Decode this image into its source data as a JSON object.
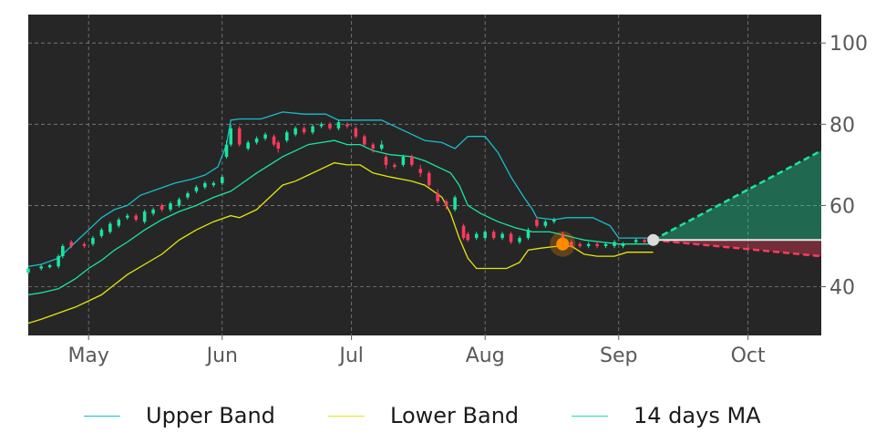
{
  "chart_data": {
    "type": "candlestick",
    "title": "",
    "xlabel": "",
    "ylabel": "",
    "x_axis": {
      "type": "date",
      "range": [
        "2021-04-17",
        "2021-10-18"
      ],
      "tick_labels": [
        {
          "date": "2021-05-01",
          "label": "May"
        },
        {
          "date": "2021-06-01",
          "label": "Jun"
        },
        {
          "date": "2021-07-01",
          "label": "Jul"
        },
        {
          "date": "2021-08-01",
          "label": "Aug"
        },
        {
          "date": "2021-09-01",
          "label": "Sep"
        },
        {
          "date": "2021-10-01",
          "label": "Oct"
        }
      ]
    },
    "y_axis": {
      "range": [
        28,
        107
      ],
      "ticks": [
        40,
        60,
        80,
        100
      ],
      "side": "right"
    },
    "grid": true,
    "background": "#262626",
    "legend": {
      "placement": "bottom",
      "entries": [
        {
          "label": "Upper Band",
          "color": "#17becf"
        },
        {
          "label": "Lower Band",
          "color": "#e5e510"
        },
        {
          "label": "14 days MA",
          "color": "#19e6a0"
        }
      ]
    },
    "series": [
      {
        "name": "Upper Band",
        "color": "#17becf",
        "points": [
          [
            "2021-04-17",
            45
          ],
          [
            "2021-04-20",
            45.5
          ],
          [
            "2021-04-24",
            47
          ],
          [
            "2021-04-28",
            51
          ],
          [
            "2021-05-01",
            54
          ],
          [
            "2021-05-04",
            57
          ],
          [
            "2021-05-07",
            59
          ],
          [
            "2021-05-10",
            60
          ],
          [
            "2021-05-13",
            62.5
          ],
          [
            "2021-05-17",
            64
          ],
          [
            "2021-05-21",
            65.5
          ],
          [
            "2021-05-25",
            66.5
          ],
          [
            "2021-05-28",
            67.5
          ],
          [
            "2021-05-31",
            69.5
          ],
          [
            "2021-06-02",
            75
          ],
          [
            "2021-06-03",
            81
          ],
          [
            "2021-06-05",
            81.3
          ],
          [
            "2021-06-10",
            81.3
          ],
          [
            "2021-06-15",
            83
          ],
          [
            "2021-06-20",
            82.5
          ],
          [
            "2021-06-25",
            82.5
          ],
          [
            "2021-06-28",
            81
          ],
          [
            "2021-07-08",
            81
          ],
          [
            "2021-07-10",
            80
          ],
          [
            "2021-07-14",
            78
          ],
          [
            "2021-07-18",
            76
          ],
          [
            "2021-07-22",
            75.5
          ],
          [
            "2021-07-25",
            74
          ],
          [
            "2021-07-28",
            77
          ],
          [
            "2021-08-01",
            77
          ],
          [
            "2021-08-04",
            73
          ],
          [
            "2021-08-07",
            67
          ],
          [
            "2021-08-10",
            62
          ],
          [
            "2021-08-12",
            59
          ],
          [
            "2021-08-13",
            57
          ],
          [
            "2021-08-17",
            56.5
          ],
          [
            "2021-08-20",
            57
          ],
          [
            "2021-08-26",
            57
          ],
          [
            "2021-08-30",
            55
          ],
          [
            "2021-09-01",
            52
          ],
          [
            "2021-09-03",
            52
          ],
          [
            "2021-09-09",
            52
          ]
        ]
      },
      {
        "name": "Lower Band",
        "color": "#e5e510",
        "points": [
          [
            "2021-04-17",
            31
          ],
          [
            "2021-04-20",
            32
          ],
          [
            "2021-04-24",
            33.5
          ],
          [
            "2021-04-28",
            35
          ],
          [
            "2021-05-01",
            36.5
          ],
          [
            "2021-05-04",
            38
          ],
          [
            "2021-05-07",
            40.5
          ],
          [
            "2021-05-10",
            43
          ],
          [
            "2021-05-14",
            45.5
          ],
          [
            "2021-05-18",
            48
          ],
          [
            "2021-05-22",
            51.5
          ],
          [
            "2021-05-26",
            54
          ],
          [
            "2021-05-30",
            56
          ],
          [
            "2021-06-03",
            57.5
          ],
          [
            "2021-06-05",
            57
          ],
          [
            "2021-06-09",
            59
          ],
          [
            "2021-06-12",
            62
          ],
          [
            "2021-06-15",
            65
          ],
          [
            "2021-06-18",
            66
          ],
          [
            "2021-06-21",
            67.5
          ],
          [
            "2021-06-24",
            69
          ],
          [
            "2021-06-27",
            70.5
          ],
          [
            "2021-06-30",
            70
          ],
          [
            "2021-07-03",
            70
          ],
          [
            "2021-07-06",
            68
          ],
          [
            "2021-07-10",
            67
          ],
          [
            "2021-07-15",
            66
          ],
          [
            "2021-07-18",
            65
          ],
          [
            "2021-07-22",
            62
          ],
          [
            "2021-07-24",
            58
          ],
          [
            "2021-07-26",
            52
          ],
          [
            "2021-07-28",
            47
          ],
          [
            "2021-07-30",
            44.5
          ],
          [
            "2021-08-03",
            44.5
          ],
          [
            "2021-08-06",
            44.5
          ],
          [
            "2021-08-09",
            46
          ],
          [
            "2021-08-11",
            49
          ],
          [
            "2021-08-14",
            49.5
          ],
          [
            "2021-08-18",
            50
          ],
          [
            "2021-08-21",
            50
          ],
          [
            "2021-08-24",
            48
          ],
          [
            "2021-08-27",
            47.5
          ],
          [
            "2021-08-31",
            47.5
          ],
          [
            "2021-09-03",
            48.5
          ],
          [
            "2021-09-09",
            48.5
          ]
        ]
      },
      {
        "name": "14 days MA",
        "color": "#19e6a0",
        "points": [
          [
            "2021-04-17",
            38
          ],
          [
            "2021-04-20",
            38.5
          ],
          [
            "2021-04-24",
            39.5
          ],
          [
            "2021-04-28",
            42
          ],
          [
            "2021-05-01",
            44.5
          ],
          [
            "2021-05-04",
            46.5
          ],
          [
            "2021-05-07",
            49
          ],
          [
            "2021-05-10",
            51
          ],
          [
            "2021-05-14",
            54
          ],
          [
            "2021-05-18",
            56.5
          ],
          [
            "2021-05-22",
            58.5
          ],
          [
            "2021-05-26",
            60
          ],
          [
            "2021-05-30",
            62
          ],
          [
            "2021-06-03",
            63.5
          ],
          [
            "2021-06-05",
            65
          ],
          [
            "2021-06-09",
            68
          ],
          [
            "2021-06-12",
            70
          ],
          [
            "2021-06-15",
            72
          ],
          [
            "2021-06-18",
            73.5
          ],
          [
            "2021-06-21",
            75
          ],
          [
            "2021-06-24",
            75.5
          ],
          [
            "2021-06-27",
            76
          ],
          [
            "2021-06-30",
            75
          ],
          [
            "2021-07-03",
            75
          ],
          [
            "2021-07-06",
            73.5
          ],
          [
            "2021-07-10",
            72.5
          ],
          [
            "2021-07-15",
            72
          ],
          [
            "2021-07-18",
            71
          ],
          [
            "2021-07-22",
            69
          ],
          [
            "2021-07-24",
            68
          ],
          [
            "2021-07-26",
            65
          ],
          [
            "2021-07-28",
            60
          ],
          [
            "2021-07-31",
            58
          ],
          [
            "2021-08-04",
            56
          ],
          [
            "2021-08-08",
            54.5
          ],
          [
            "2021-08-12",
            53.5
          ],
          [
            "2021-08-16",
            53.5
          ],
          [
            "2021-08-20",
            52.5
          ],
          [
            "2021-08-24",
            51.5
          ],
          [
            "2021-08-28",
            51
          ],
          [
            "2021-09-01",
            50.5
          ],
          [
            "2021-09-05",
            50.5
          ],
          [
            "2021-09-09",
            50.5
          ]
        ]
      }
    ],
    "candles": [
      [
        "2021-04-17",
        43.5,
        44.5,
        44,
        43
      ],
      [
        "2021-04-20",
        44.5,
        45,
        45.5,
        44
      ],
      [
        "2021-04-22",
        44.8,
        45.3,
        45.6,
        44.5
      ],
      [
        "2021-04-24",
        45,
        47.5,
        48,
        44.5
      ],
      [
        "2021-04-25",
        47.5,
        50,
        50.5,
        47
      ],
      [
        "2021-04-27",
        51,
        50,
        51.5,
        49.5
      ],
      [
        "2021-04-30",
        50.5,
        50,
        51,
        49.5
      ],
      [
        "2021-05-02",
        50.5,
        52,
        52.5,
        50
      ],
      [
        "2021-05-04",
        52.5,
        54,
        54.5,
        52
      ],
      [
        "2021-05-06",
        53.5,
        55.5,
        56,
        53
      ],
      [
        "2021-05-08",
        55,
        56.5,
        57,
        54.5
      ],
      [
        "2021-05-10",
        57,
        57.5,
        58,
        56.5
      ],
      [
        "2021-05-12",
        57.5,
        56.5,
        58,
        56
      ],
      [
        "2021-05-14",
        56,
        58.5,
        59,
        55.5
      ],
      [
        "2021-05-16",
        58,
        59,
        59.5,
        57.5
      ],
      [
        "2021-05-18",
        60,
        59,
        60.5,
        58.5
      ],
      [
        "2021-05-20",
        59,
        60.5,
        61,
        58.5
      ],
      [
        "2021-05-22",
        60,
        61.5,
        62,
        59.5
      ],
      [
        "2021-05-24",
        62,
        63,
        63.5,
        61.5
      ],
      [
        "2021-05-26",
        63.5,
        64.5,
        65,
        63
      ],
      [
        "2021-05-28",
        64.5,
        65.5,
        66,
        64
      ],
      [
        "2021-05-30",
        65,
        65.5,
        66,
        64.5
      ],
      [
        "2021-06-01",
        65.5,
        67,
        67.5,
        65
      ],
      [
        "2021-06-02",
        72,
        75,
        76,
        71.5
      ],
      [
        "2021-06-03",
        75,
        79,
        80,
        74.5
      ],
      [
        "2021-06-05",
        79,
        75,
        79.5,
        74.5
      ],
      [
        "2021-06-07",
        74,
        75.5,
        76,
        73.5
      ],
      [
        "2021-06-09",
        75.5,
        76.5,
        77,
        75
      ],
      [
        "2021-06-11",
        76.5,
        77.5,
        78,
        76
      ],
      [
        "2021-06-13",
        77,
        75,
        77.5,
        74.5
      ],
      [
        "2021-06-14",
        75.5,
        74,
        76,
        73
      ],
      [
        "2021-06-16",
        76,
        78,
        78.5,
        75.5
      ],
      [
        "2021-06-18",
        77.5,
        79,
        79.5,
        77
      ],
      [
        "2021-06-20",
        79,
        78,
        79.5,
        77.5
      ],
      [
        "2021-06-22",
        78,
        79.5,
        80,
        77.5
      ],
      [
        "2021-06-24",
        79.5,
        80,
        80.5,
        79
      ],
      [
        "2021-06-26",
        80,
        79,
        80.5,
        78.5
      ],
      [
        "2021-06-28",
        79,
        80.5,
        81,
        78.5
      ],
      [
        "2021-06-30",
        80,
        79.5,
        80.5,
        79
      ],
      [
        "2021-07-02",
        79,
        77,
        79.5,
        76.5
      ],
      [
        "2021-07-04",
        77,
        75,
        77.5,
        74.5
      ],
      [
        "2021-07-06",
        75,
        74,
        75.5,
        73
      ],
      [
        "2021-07-08",
        74,
        75,
        76,
        73.5
      ],
      [
        "2021-07-09",
        72,
        70,
        72.5,
        69
      ],
      [
        "2021-07-11",
        70,
        69.5,
        70.5,
        69
      ],
      [
        "2021-07-13",
        70,
        72,
        72.5,
        69.5
      ],
      [
        "2021-07-15",
        72,
        70,
        72.5,
        69.5
      ],
      [
        "2021-07-17",
        69,
        68,
        70,
        67
      ],
      [
        "2021-07-19",
        68,
        65,
        68.5,
        64.5
      ],
      [
        "2021-07-21",
        63,
        61,
        64,
        60.5
      ],
      [
        "2021-07-23",
        61,
        60,
        61.5,
        59
      ],
      [
        "2021-07-25",
        59,
        62,
        62.5,
        58.5
      ],
      [
        "2021-07-27",
        55,
        52,
        55.5,
        51.5
      ],
      [
        "2021-07-28",
        53,
        51.5,
        53.5,
        51
      ],
      [
        "2021-07-30",
        52,
        53,
        53.5,
        51.5
      ],
      [
        "2021-08-01",
        52,
        53.5,
        54,
        51.5
      ],
      [
        "2021-08-03",
        53.5,
        52,
        54,
        51.5
      ],
      [
        "2021-08-05",
        52,
        53,
        53.5,
        51.5
      ],
      [
        "2021-08-07",
        53,
        51,
        53.5,
        50.5
      ],
      [
        "2021-08-09",
        51,
        52,
        52.5,
        50.5
      ],
      [
        "2021-08-11",
        52,
        54,
        54.5,
        51.5
      ],
      [
        "2021-08-13",
        56.5,
        55,
        57,
        54.5
      ],
      [
        "2021-08-15",
        55,
        56,
        56.5,
        54.5
      ],
      [
        "2021-08-17",
        56,
        56.5,
        57,
        55.5
      ],
      [
        "2021-08-19",
        53,
        51,
        53.5,
        50.5
      ],
      [
        "2021-08-21",
        51,
        50,
        51.5,
        49.5
      ],
      [
        "2021-08-23",
        50.5,
        50,
        51,
        49.5
      ],
      [
        "2021-08-25",
        50,
        50.5,
        51,
        49.5
      ],
      [
        "2021-08-27",
        50.5,
        50,
        51,
        49.5
      ],
      [
        "2021-08-29",
        50,
        50.5,
        51,
        49.5
      ],
      [
        "2021-08-31",
        50,
        51,
        51.5,
        49.5
      ],
      [
        "2021-09-02",
        50,
        50.5,
        51,
        49.5
      ],
      [
        "2021-09-05",
        51,
        51.5,
        52,
        50.5
      ],
      [
        "2021-09-07",
        51.5,
        51,
        52,
        50.5
      ]
    ],
    "annotations": {
      "marker": {
        "date": "2021-08-19",
        "value": 50.5,
        "color": "#ff8c00"
      },
      "last_close": {
        "date": "2021-09-09",
        "value": 51.5
      },
      "projection": {
        "start_date": "2021-09-09",
        "end_date": "2021-10-18",
        "start_value": 51.5,
        "upper_end": 73.5,
        "lower_end": 47.5,
        "upper_color": "#19e6a0",
        "lower_color": "#ff3b5c"
      }
    }
  },
  "legend": {
    "upper_band": "Upper Band",
    "lower_band": "Lower Band",
    "ma": "14 days MA"
  }
}
